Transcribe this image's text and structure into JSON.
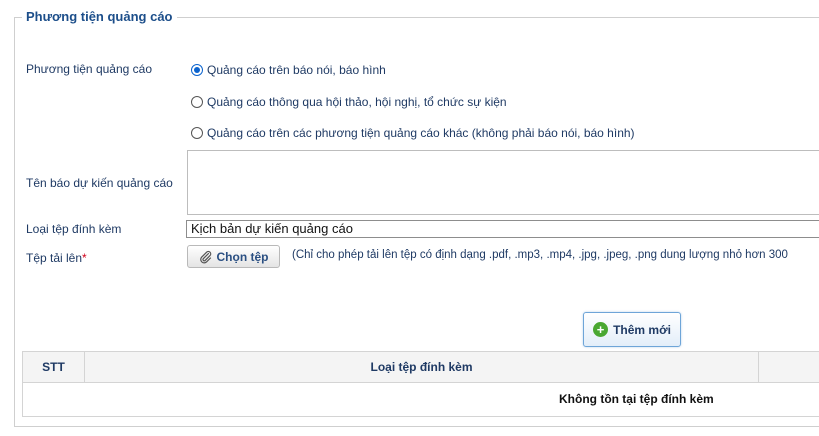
{
  "section": {
    "legend": "Phương tiện quảng cáo"
  },
  "ad_medium": {
    "label": "Phương tiện quảng cáo",
    "options": [
      {
        "label": "Quảng cáo trên báo nói, báo hình",
        "checked": true
      },
      {
        "label": "Quảng cáo thông qua hội thảo, hội nghị, tổ chức sự kiện",
        "checked": false
      },
      {
        "label": "Quảng cáo trên các phương tiện quảng cáo khác (không phải báo nói, báo hình)",
        "checked": false
      }
    ]
  },
  "newspaper": {
    "label": "Tên báo dự kiến quảng cáo",
    "value": ""
  },
  "attachment_type": {
    "label": "Loại tệp đính kèm",
    "selected": "Kịch bản dự kiến quảng cáo"
  },
  "upload": {
    "label": "Tệp tải lên",
    "required_mark": "*",
    "button_label": "Chọn tệp",
    "hint": "(Chỉ cho phép tải lên tệp có định dạng .pdf, .mp3, .mp4, .jpg, .jpeg, .png dung lượng nhỏ hơn 300"
  },
  "add_button": {
    "label": "Thêm mới"
  },
  "table": {
    "columns": [
      "STT",
      "Loại tệp đính kèm",
      ""
    ],
    "empty_message": "Không tồn tại tệp đính kèm"
  },
  "colors": {
    "accent": "#0b63ce",
    "add_icon": "#4aa832",
    "required": "#d0021b"
  }
}
